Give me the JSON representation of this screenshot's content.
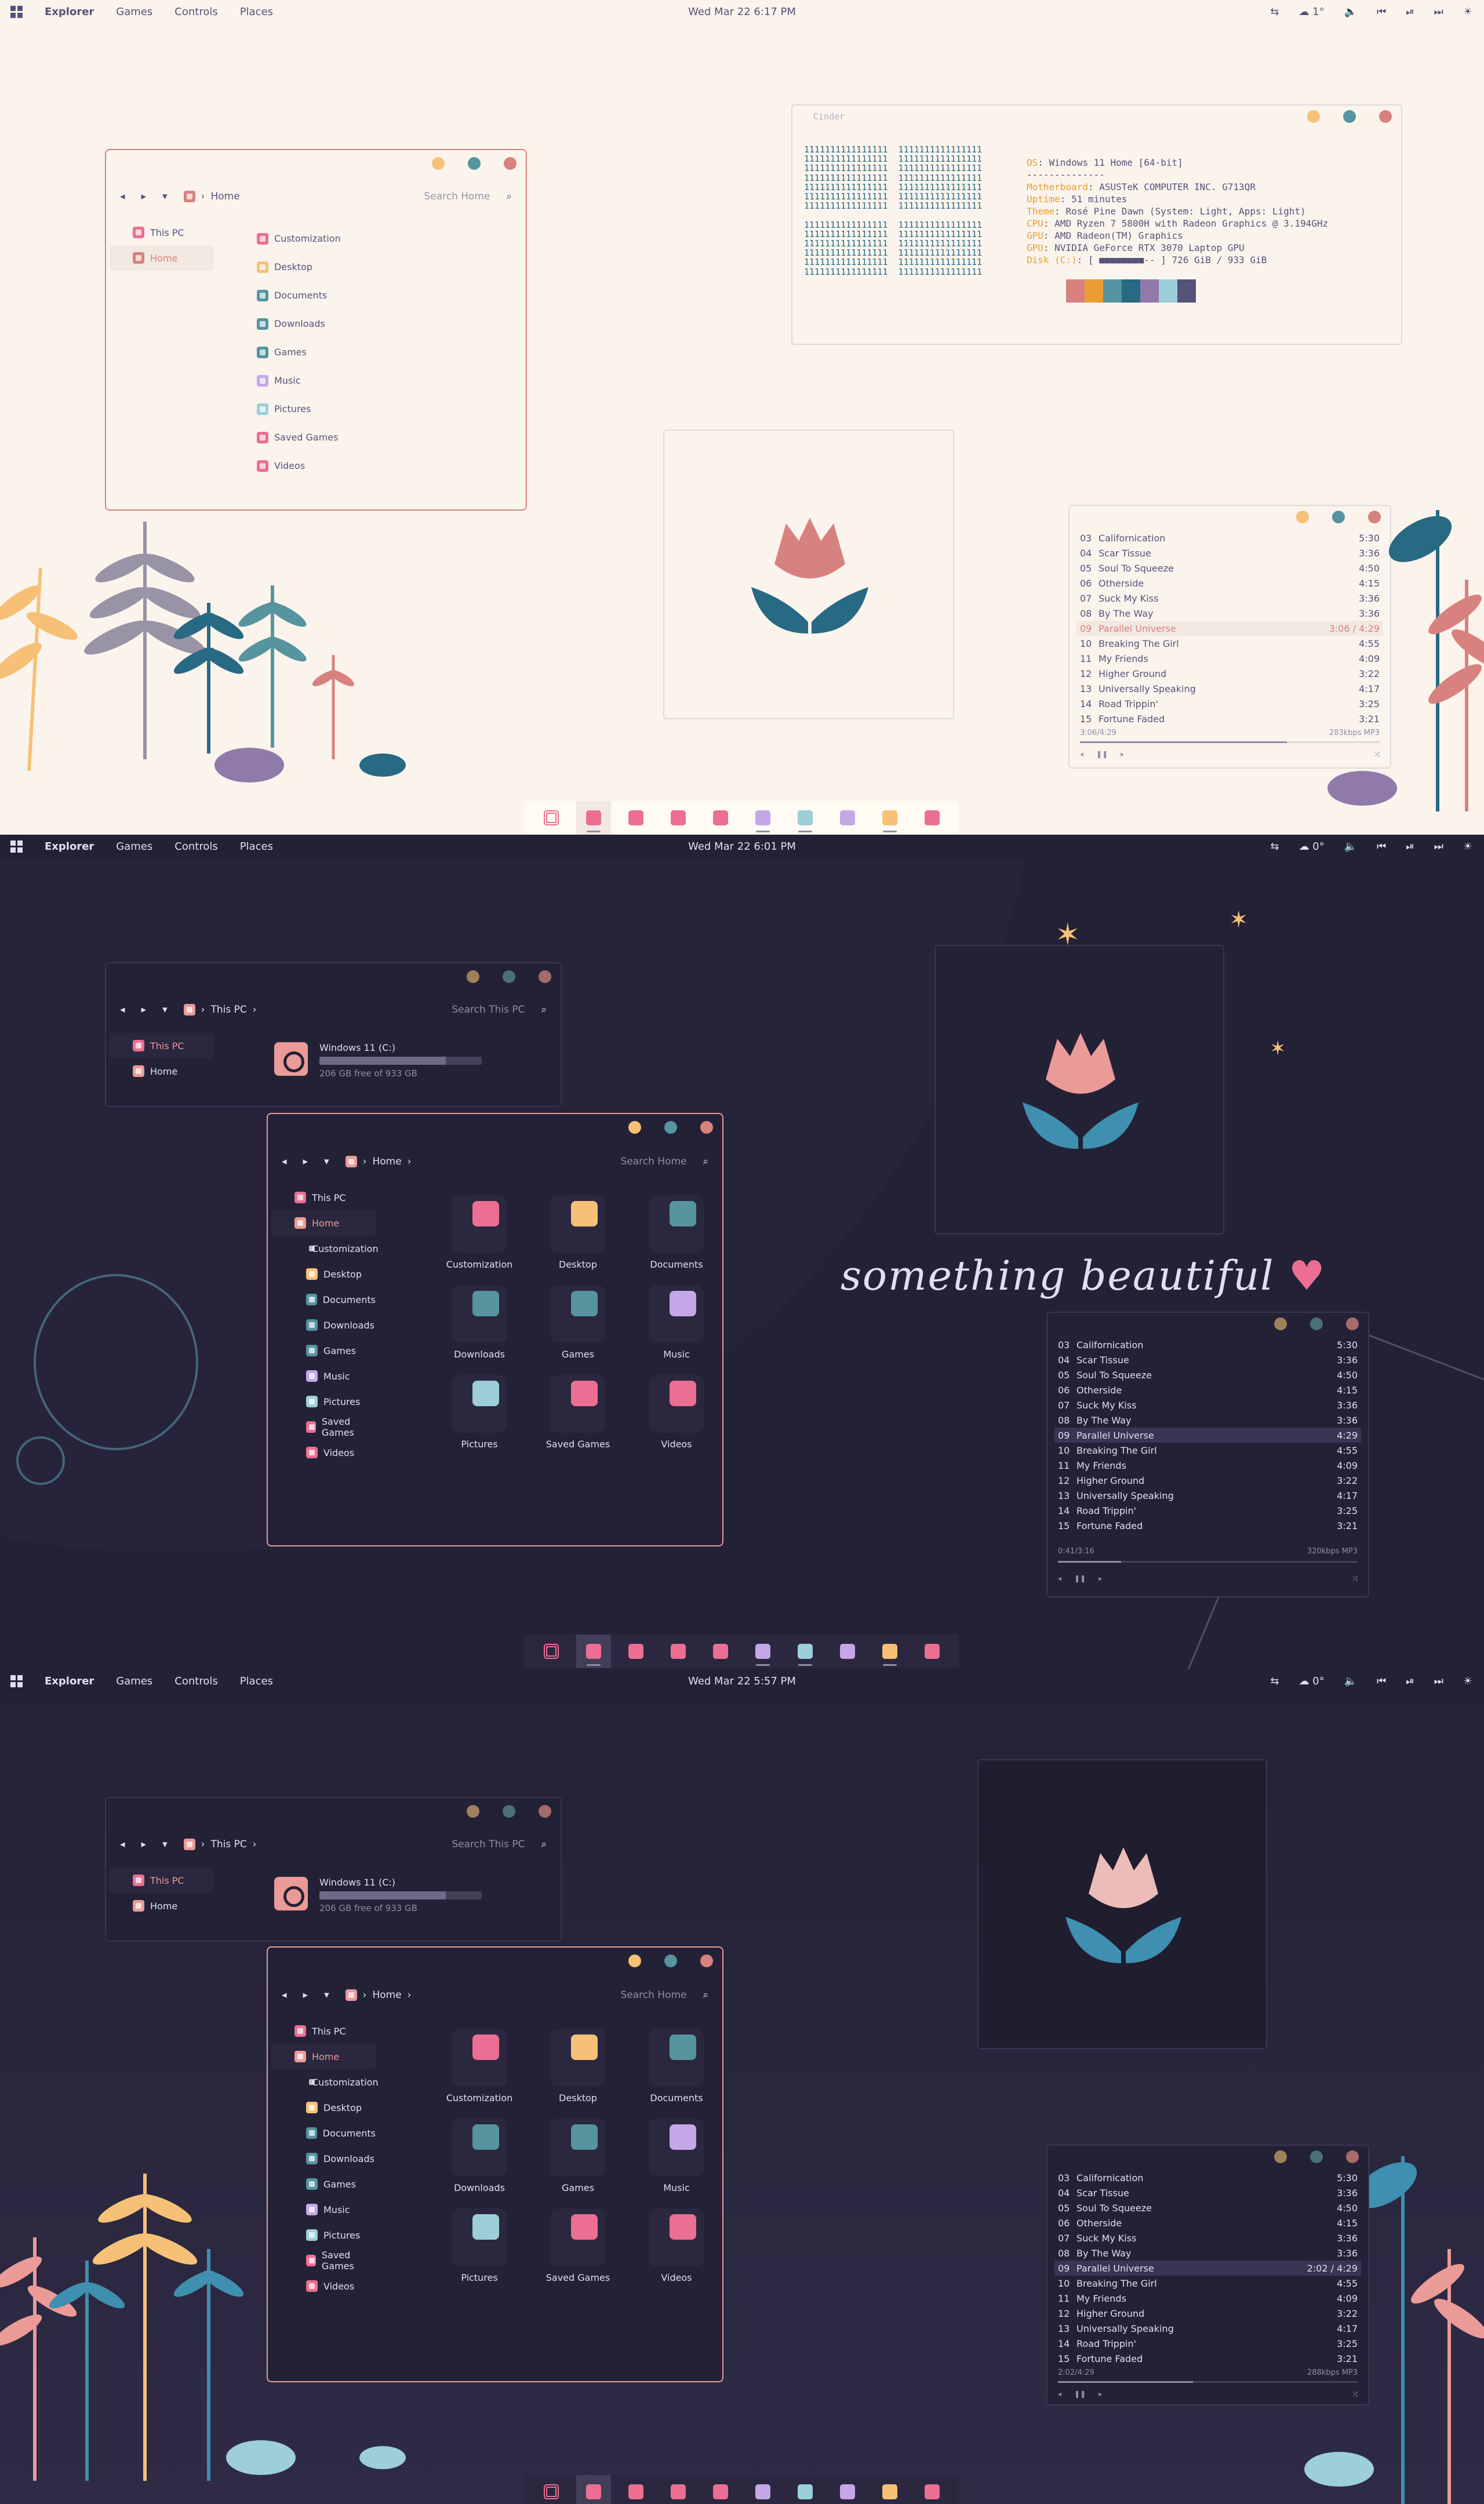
{
  "colors": {
    "rose": "#d7827e",
    "rose_dark": "#ea9a97",
    "gold": "#f6c177",
    "pine": "#286983",
    "foam": "#56949f",
    "iris": "#907aa9",
    "love": "#eb6f92",
    "text_light": "#575279",
    "text_dark": "#e0def4",
    "muted": "#908caa",
    "base_light": "#faf4ed",
    "base_dark": "#232136"
  },
  "topbar": {
    "menu": [
      "Explorer",
      "Games",
      "Controls",
      "Places"
    ],
    "clocks": [
      "Wed Mar 22  6:17 PM",
      "Wed Mar 22  6:01 PM",
      "Wed Mar 22  5:57 PM"
    ],
    "weather": [
      "1°",
      "0°",
      "0°"
    ],
    "icons": [
      "windows-icon",
      "sync-icon",
      "cloud-icon",
      "volume-icon",
      "prev-icon",
      "play-pause-icon",
      "next-icon",
      "settings-icon"
    ]
  },
  "explorer_home": {
    "path": "Home",
    "search_placeholder": "Search Home",
    "sidebar": [
      "This PC",
      "Home"
    ],
    "folders": [
      "Customization",
      "Desktop",
      "Documents",
      "Downloads",
      "Games",
      "Music",
      "Pictures",
      "Saved Games",
      "Videos"
    ],
    "folder_colors": [
      "#eb6f92",
      "#f6c177",
      "#56949f",
      "#56949f",
      "#56949f",
      "#c4a7e7",
      "#9ccfd8",
      "#eb6f92",
      "#eb6f92"
    ],
    "grid": [
      "Customization",
      "Desktop",
      "Documents",
      "Downloads",
      "Games",
      "Music",
      "Pictures",
      "Saved Games",
      "Videos"
    ]
  },
  "explorer_pc": {
    "path": "This PC",
    "search_placeholder": "Search This PC",
    "drive_name": "Windows 11 (C:)",
    "drive_free": "206 GB free of 933 GB",
    "drive_used_fraction": 0.78
  },
  "terminal": {
    "title": "Cinder",
    "art_line": "1111111111111111  1111111111111111",
    "info": [
      {
        "key": "OS",
        "val": ": Windows 11 Home [64-bit]"
      },
      {
        "key": "",
        "val": "--------------"
      },
      {
        "key": "Motherboard",
        "val": ": ASUSTeK COMPUTER INC. G713QR"
      },
      {
        "key": "Uptime",
        "val": ": 51 minutes"
      },
      {
        "key": "Theme",
        "val": ": Rosé Pine Dawn (System: Light, Apps: Light)"
      },
      {
        "key": "CPU",
        "val": ": AMD Ryzen 7 5800H with Radeon Graphics @ 3.194GHz"
      },
      {
        "key": "GPU",
        "val": ": AMD Radeon(TM) Graphics"
      },
      {
        "key": "GPU",
        "val": ": NVIDIA GeForce RTX 3070 Laptop GPU"
      },
      {
        "key": "Disk (C:)",
        "val": ": [ ■■■■■■■■-- ] 726 GiB / 933 GiB"
      }
    ],
    "palette": [
      "#faf4ed",
      "#d7827e",
      "#ea9d34",
      "#56949f",
      "#286983",
      "#907aa9",
      "#9ccfd8",
      "#575279"
    ]
  },
  "player": {
    "tracks": [
      {
        "num": "03",
        "title": "Californication",
        "dur": "5:30"
      },
      {
        "num": "04",
        "title": "Scar Tissue",
        "dur": "3:36"
      },
      {
        "num": "05",
        "title": "Soul To Squeeze",
        "dur": "4:50"
      },
      {
        "num": "06",
        "title": "Otherside",
        "dur": "4:15"
      },
      {
        "num": "07",
        "title": "Suck My Kiss",
        "dur": "3:36"
      },
      {
        "num": "08",
        "title": "By The Way",
        "dur": "3:36"
      },
      {
        "num": "09",
        "title": "Parallel Universe",
        "dur": "4:29"
      },
      {
        "num": "10",
        "title": "Breaking The Girl",
        "dur": "4:55"
      },
      {
        "num": "11",
        "title": "My Friends",
        "dur": "4:09"
      },
      {
        "num": "12",
        "title": "Higher Ground",
        "dur": "3:22"
      },
      {
        "num": "13",
        "title": "Universally Speaking",
        "dur": "4:17"
      },
      {
        "num": "14",
        "title": "Road Trippin'",
        "dur": "3:25"
      },
      {
        "num": "15",
        "title": "Fortune Faded",
        "dur": "3:21"
      }
    ],
    "current_index": 6,
    "current_labels": [
      "3:06 / 4:29",
      "4:29",
      "2:02 / 4:29"
    ],
    "position_labels": [
      "3:06/4:29",
      "0:41/3:16",
      "2:02/4:29"
    ],
    "bitrates": [
      "283kbps MP3",
      "320kbps MP3",
      "288kbps MP3"
    ],
    "progress": [
      0.69,
      0.21,
      0.45
    ]
  },
  "tagline": "something beautiful",
  "dock": {
    "icons": [
      "apps-icon",
      "folder-icon",
      "music-disc-icon",
      "home-icon",
      "steam-icon",
      "music-icon",
      "image-icon",
      "more-icon",
      "star-icon",
      "stripes-icon"
    ],
    "colors": [
      "#eb6f92",
      "#eb6f92",
      "#eb6f92",
      "#eb6f92",
      "#eb6f92",
      "#c4a7e7",
      "#9ccfd8",
      "#c4a7e7",
      "#f6c177",
      "#eb6f92"
    ]
  }
}
